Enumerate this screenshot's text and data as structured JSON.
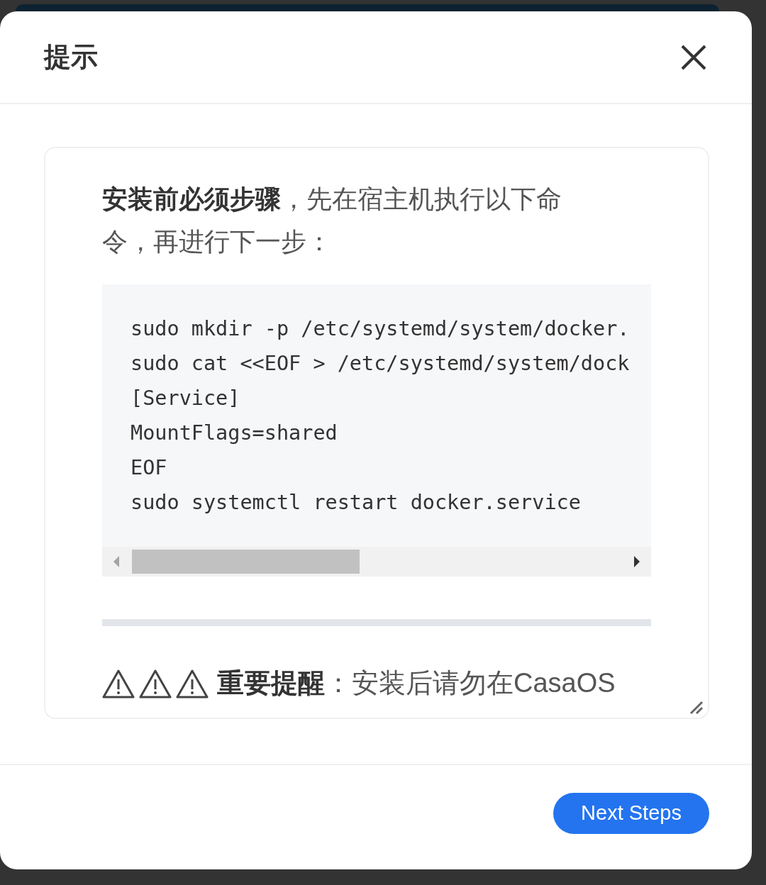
{
  "dialog": {
    "title": "提示",
    "message": "**安装前必须步骤**，先在宿主机执行以下命令，再进行下一步：",
    "code_lines": [
      "sudo mkdir -p /etc/systemd/system/docker.",
      "sudo cat <<EOF > /etc/systemd/system/dock",
      "[Service]",
      "MountFlags=shared",
      "EOF",
      "sudo systemctl restart docker.service"
    ],
    "warning": "**重要提醒**：安装后请勿在CasaOS",
    "button": "Next Steps"
  }
}
